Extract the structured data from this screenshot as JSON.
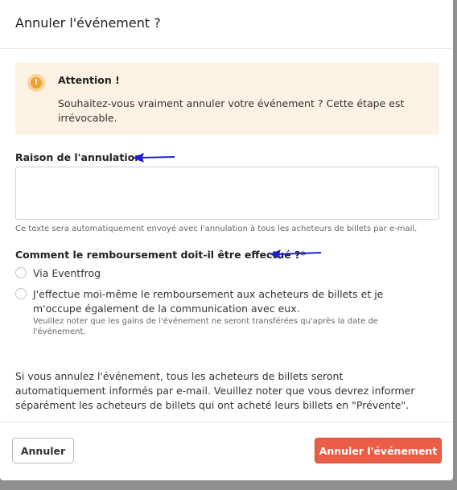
{
  "modal": {
    "title": "Annuler l'événement ?"
  },
  "alert": {
    "icon": "warning-icon",
    "icon_glyph": "!",
    "title": "Attention !",
    "text": "Souhaitez-vous vraiment annuler votre événement ? Cette étape est irrévocable."
  },
  "reason": {
    "label": "Raison de l'annulation",
    "value": "",
    "help": "Ce texte sera automatiquement envoyé avec l'annulation à tous les acheteurs de billets par e-mail."
  },
  "refund": {
    "label": "Comment le remboursement doit-il être effectué ?*",
    "options": [
      {
        "label": "Via Eventfrog",
        "selected": false
      },
      {
        "label": "J'effectue moi-même le remboursement aux acheteurs de billets et je m'occupe également de la communication avec eux.",
        "selected": false,
        "note": "Veuillez noter que les gains de l'événement ne seront transférées qu'après la date de l'événement."
      }
    ]
  },
  "info": {
    "text": "Si vous annulez l'événement, tous les acheteurs de billets seront automatiquement informés par e-mail. Veuillez noter que vous devrez informer séparément les acheteurs de billets qui ont acheté leurs billets en \"Prévente\"."
  },
  "footer": {
    "cancel_label": "Annuler",
    "confirm_label": "Annuler l'événement"
  },
  "colors": {
    "danger": "#ec5d48",
    "alert_bg": "#fcf2e3",
    "warning": "#f0a230",
    "annotation_arrow": "#1f1fd6"
  }
}
